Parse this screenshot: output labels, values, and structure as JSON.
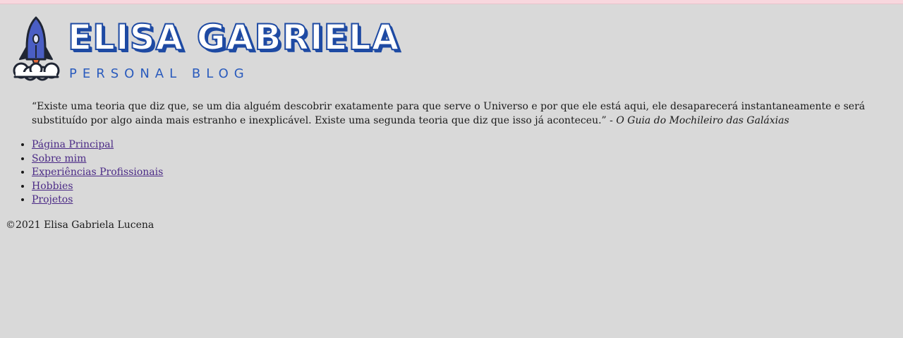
{
  "header": {
    "title": "ELISA GABRIELA",
    "subtitle": "PERSONAL BLOG",
    "logo_icon": "rocket-icon"
  },
  "quote": {
    "text": "“Existe uma teoria que diz que, se um dia alguém descobrir exatamente para que serve o Universo e por que ele está aqui, ele desaparecerá instantaneamente e será substituído por algo ainda mais estranho e inexplicável. Existe uma segunda teoria que diz que isso já aconteceu.”",
    "separator": " - ",
    "source": "O Guia do Mochileiro das Galáxias"
  },
  "nav": {
    "items": [
      {
        "label": "Página Principal"
      },
      {
        "label": "Sobre mim"
      },
      {
        "label": "Experiências Profissionais"
      },
      {
        "label": "Hobbies"
      },
      {
        "label": "Projetos"
      }
    ]
  },
  "footer": {
    "copyright_symbol": "©",
    "text": "2021 Elisa Gabriela Lucena"
  },
  "colors": {
    "background": "#d9d9d9",
    "top_bar": "#f8d7de",
    "title_blue": "#1e4aa3",
    "link": "#4b2a86"
  }
}
